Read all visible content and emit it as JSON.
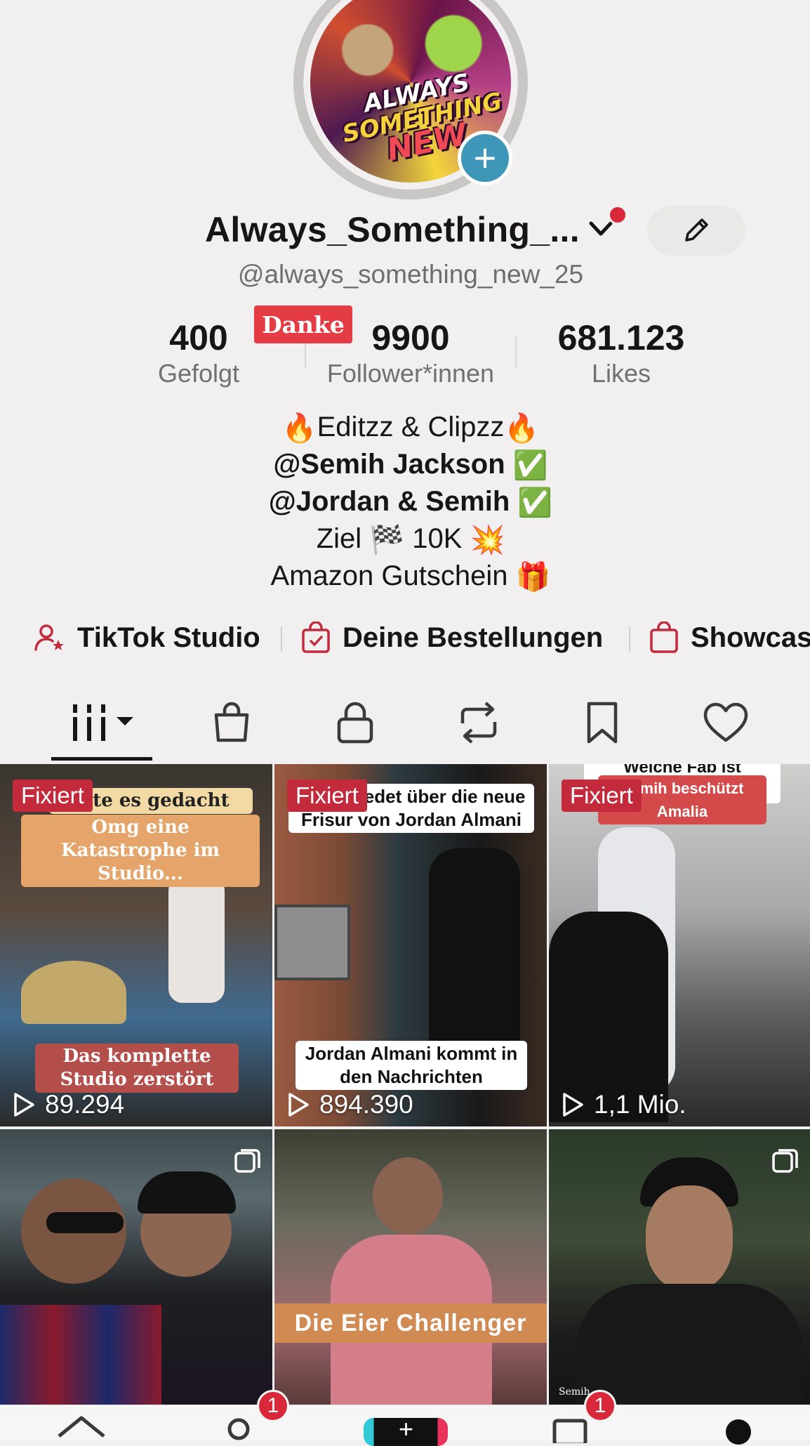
{
  "profile": {
    "display_name": "Always_Something_...",
    "username": "@always_something_new_25",
    "avatar_text": [
      "ALWAYS",
      "SOMETHING",
      "NEW"
    ],
    "danke_badge": "Danke"
  },
  "stats": [
    {
      "value": "400",
      "label": "Gefolgt"
    },
    {
      "value": "9900",
      "label": "Follower*innen"
    },
    {
      "value": "681.123",
      "label": "Likes"
    }
  ],
  "bio": {
    "line1": "Editzz & Clipzz",
    "line2": "@Semih Jackson",
    "line3": "@Jordan & Semih",
    "line4_a": "Ziel",
    "line4_b": "10K",
    "line5": "Amazon Gutschein"
  },
  "links": [
    {
      "label": "TikTok Studio",
      "icon": "person-star-icon"
    },
    {
      "label": "Deine Bestellungen",
      "icon": "order-bag-icon"
    },
    {
      "label": "Showcase",
      "icon": "shopping-bag-icon"
    }
  ],
  "tabs": [
    "videos-grid-icon",
    "shop-bag-icon",
    "lock-icon",
    "repost-icon",
    "bookmark-icon",
    "heart-icon"
  ],
  "videos": [
    {
      "pinned_label": "Fixiert",
      "views": "89.294",
      "caption_top_1": "atte es gedacht",
      "caption_top_2": "Omg eine Katastrophe im Studio...",
      "caption_bottom": "Das komplette Studio zerstört"
    },
    {
      "pinned_label": "Fixiert",
      "views": "894.390",
      "caption_top": "chum Redet über die neue Frisur von Jordan Almani",
      "caption_bottom": "Jordan Almani kommt in den Nachrichten"
    },
    {
      "pinned_label": "Fixiert",
      "views": "1,1 Mio.",
      "caption_top": "Welche Fab ist schlimmer",
      "caption_top_2": "Semih beschützt Amalia"
    },
    {
      "caption": ""
    },
    {
      "caption": "Die Eier Challenger"
    },
    {
      "watermark": "Semih"
    }
  ],
  "bottom_nav": {
    "friends_badge": "1",
    "inbox_badge": "1"
  },
  "colors": {
    "background": "#f1efef",
    "accent_red": "#e53b44",
    "pinned_red": "#c32b3c",
    "add_blue": "#3e97b9"
  }
}
